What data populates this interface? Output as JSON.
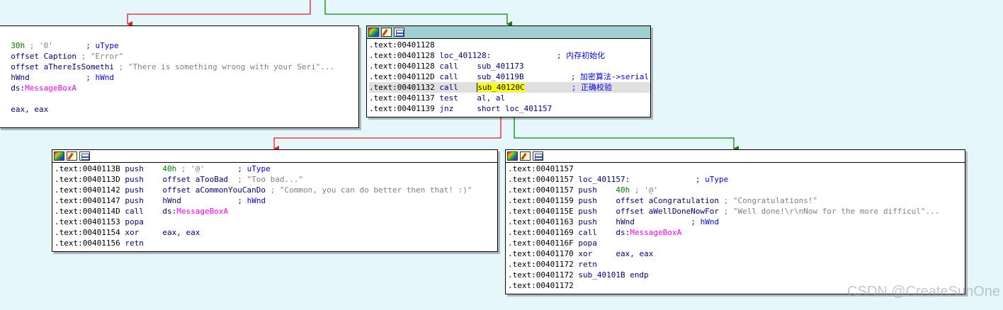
{
  "nodes": {
    "error_block": {
      "lines": [
        {
          "op": "30h",
          "mid": " ; '0'",
          "cmt": "; uType"
        },
        {
          "op": "offset Caption",
          "mid": " ; \"Error\""
        },
        {
          "op": "offset aThereIsSomethi",
          "mid": " ; \"There is something wrong with your Seri\"..."
        },
        {
          "op": "hWnd",
          "cmt": "; hWnd"
        },
        {
          "op_prefix": "ds:",
          "imp": "MessageBoxA"
        },
        {
          "op": ""
        },
        {
          "op": "eax, eax"
        }
      ]
    },
    "main_block": {
      "lines": [
        {
          "addr": ".text:00401128"
        },
        {
          "addr": ".text:00401128",
          "label": "loc_401128:",
          "cmt": "; 内存初始化"
        },
        {
          "addr": ".text:00401128",
          "mn": "call",
          "op": "sub_401173"
        },
        {
          "addr": ".text:0040112D",
          "mn": "call",
          "op": "sub_40119B",
          "cmt": "; 加密算法->serial"
        },
        {
          "addr": ".text:00401132",
          "mn": "call",
          "op": "sub_40120C",
          "cmt": "; 正确校验"
        },
        {
          "addr": ".text:00401137",
          "mn": "test",
          "op": "al, al"
        },
        {
          "addr": ".text:00401139",
          "mn": "jnz",
          "op": "short loc_401157"
        }
      ]
    },
    "toobad_block": {
      "lines": [
        {
          "addr": ".text:0040113B",
          "mn": "push",
          "num": "40h",
          "mid": " ; '@'",
          "cmt": "; uType"
        },
        {
          "addr": ".text:0040113D",
          "mn": "push",
          "op": "offset aTooBad",
          "mid": "  ; \"Too bad...\""
        },
        {
          "addr": ".text:00401142",
          "mn": "push",
          "op": "offset aCommonYouCanDo",
          "mid": " ; \"Common, you can do better then that! :)\""
        },
        {
          "addr": ".text:00401147",
          "mn": "push",
          "op": "hWnd",
          "cmt": "; hWnd"
        },
        {
          "addr": ".text:0040114D",
          "mn": "call",
          "op_prefix": "ds:",
          "imp": "MessageBoxA"
        },
        {
          "addr": ".text:00401153",
          "mn": "popa"
        },
        {
          "addr": ".text:00401154",
          "mn": "xor",
          "op": "eax, eax"
        },
        {
          "addr": ".text:00401156",
          "mn": "retn"
        }
      ]
    },
    "congrats_block": {
      "lines": [
        {
          "addr": ".text:00401157"
        },
        {
          "addr": ".text:00401157",
          "label": "loc_401157:",
          "cmt": "; uType"
        },
        {
          "addr": ".text:00401157",
          "mn": "push",
          "num": "40h",
          "mid": " ; '@'"
        },
        {
          "addr": ".text:00401159",
          "mn": "push",
          "op": "offset aCongratulation",
          "mid": " ; \"Congratulations!\""
        },
        {
          "addr": ".text:0040115E",
          "mn": "push",
          "op": "offset aWellDoneNowFor",
          "mid": " ; \"Well done!\\r\\nNow for the more difficul\"..."
        },
        {
          "addr": ".text:00401163",
          "mn": "push",
          "op": "hWnd",
          "cmt": "; hWnd"
        },
        {
          "addr": ".text:00401169",
          "mn": "call",
          "op_prefix": "ds:",
          "imp": "MessageBoxA"
        },
        {
          "addr": ".text:0040116F",
          "mn": "popa"
        },
        {
          "addr": ".text:00401170",
          "mn": "xor",
          "op": "eax, eax"
        },
        {
          "addr": ".text:00401172",
          "mn": "retn"
        },
        {
          "addr": ".text:00401172",
          "label": "sub_40101B endp"
        },
        {
          "addr": ".text:00401172"
        }
      ]
    }
  },
  "watermark": "CSDN @CreateSunOne",
  "colors": {
    "background": "#e6f7fb",
    "edge_false": "#e02020",
    "edge_true": "#108010",
    "selected_header": "#9ed0d2",
    "highlight_token": "#ffff00",
    "import_name": "#ff00ff",
    "comment": "#0000ff"
  },
  "icons": [
    "node-color-icon",
    "edit-node-icon",
    "graph-view-icon"
  ]
}
